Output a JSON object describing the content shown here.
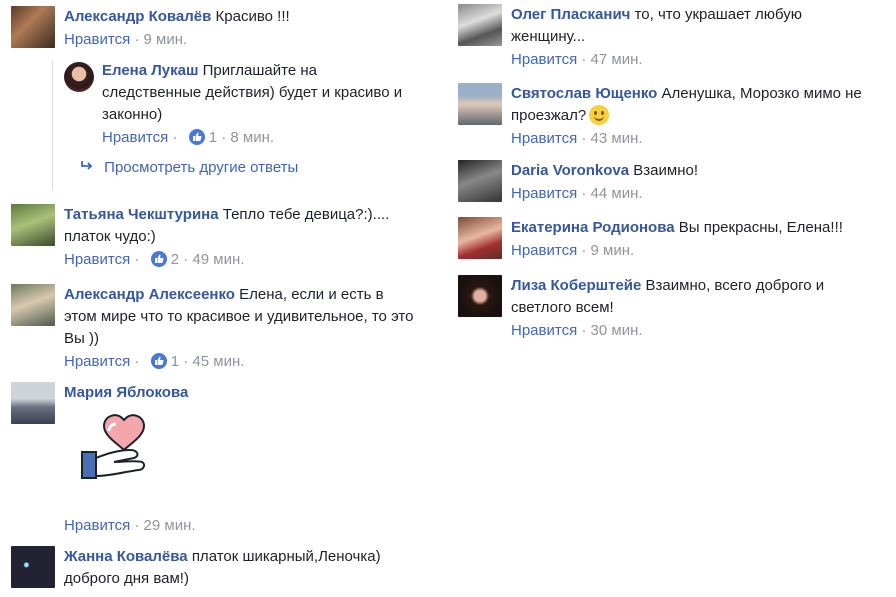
{
  "left": [
    {
      "name": "Александр Ковалёв",
      "text": "Красиво !!!",
      "like": "Нравится",
      "sep": "·",
      "likes": "",
      "time": "9 мин."
    },
    {
      "name": "Татьяна Чекштурина",
      "text": "Тепло тебе девица?:)....",
      "text2": "платок чудо:)",
      "like": "Нравится",
      "sep": "·",
      "likes": "2",
      "time": "49 мин."
    },
    {
      "name": "Александр Алексеенко",
      "text": "Елена, если и есть в",
      "text2": "этом мире что то красивое и удивительное, то это",
      "text3": "Вы ))",
      "like": "Нравится",
      "sep": "·",
      "likes": "1",
      "time": "45 мин."
    },
    {
      "name": "Мария Яблокова",
      "like": "Нравится",
      "sep": "·",
      "time": "29 мин.",
      "sticker": "heart-hand-sticker"
    },
    {
      "name": "Жанна Ковалёва",
      "text": "платок шикарный,Леночка)",
      "text2": "доброго дня вам!)"
    }
  ],
  "reply": {
    "name": "Елена Лукаш",
    "text": "Приглашайте на",
    "text2": "следственные действия) будет и красиво и",
    "text3": "законно)",
    "like": "Нравится",
    "sep": "·",
    "likes": "1",
    "time": "8 мин."
  },
  "more_replies": "Просмотреть другие ответы",
  "right": [
    {
      "name": "Олег Пласканич",
      "text": "то, что украшает любую",
      "text2": "женщину...",
      "like": "Нравится",
      "sep": "·",
      "time": "47 мин."
    },
    {
      "name": "Святослав Ющенко",
      "text": "Аленушка, Морозко мимо не",
      "text2": "проезжал?",
      "like": "Нравится",
      "sep": "·",
      "time": "43 мин."
    },
    {
      "name": "Daria Voronkova",
      "text": "Взаимно!",
      "like": "Нравится",
      "sep": "·",
      "time": "44 мин."
    },
    {
      "name": "Екатерина Родионова",
      "text": "Вы прекрасны, Елена!!!",
      "like": "Нравится",
      "sep": "·",
      "time": "9 мин."
    },
    {
      "name": "Лиза Коберштейе",
      "text": "Взаимно, всего доброго и",
      "text2": "светлого всем!",
      "like": "Нравится",
      "sep": "·",
      "time": "30 мин."
    }
  ],
  "colors": {
    "name": "#365899",
    "link": "#4267b2",
    "meta": "#90949c",
    "like_badge": "#4a76d6"
  },
  "icons": {
    "like_badge": "thumbs-up-icon",
    "reply_arrow": "reply-arrow-icon",
    "smile": "smile-emoji-icon"
  }
}
